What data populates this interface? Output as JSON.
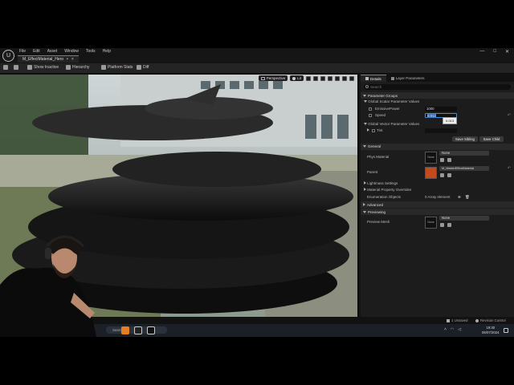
{
  "menu": {
    "logo_text": "U",
    "items": [
      "File",
      "Edit",
      "Asset",
      "Window",
      "Tools",
      "Help"
    ],
    "asset_tab": "M_EffectMaterial_Hero",
    "asset_tab_mark": "•",
    "asset_tab_close": "×",
    "window_controls": [
      "—",
      "□",
      "✕"
    ]
  },
  "toolbar": {
    "show_inactive": "Show Inactive",
    "hierarchy": "Hierarchy",
    "platform_stats": "Platform Stats",
    "diff": "Diff"
  },
  "viewport": {
    "perspective": "Perspective",
    "lit": "Lit"
  },
  "details": {
    "tab_details": "Details",
    "tab_layer": "Layer Parameters",
    "search_placeholder": "Search",
    "section_param_groups": "Parameter Groups",
    "scalar_group": "Global Scalar Parameter Values",
    "emissive_power_label": "EmissivePower",
    "emissive_power_value": "1000",
    "speed_label": "Speed",
    "speed_value": "0.013",
    "speed_tooltip": "0.013",
    "vector_group": "Global Vector Parameter Values",
    "tint_label": "Tint",
    "save_sibling": "Save Sibling",
    "save_child": "Save Child",
    "section_general": "General",
    "phys_material_label": "Phys Material",
    "none_label": "None",
    "phys_material_dd": "None",
    "parent_label": "Parent",
    "parent_value": "M_MasterEffectMaterial",
    "lightmass": "Lightmass Settings",
    "material_overrides": "Material Property Overrides",
    "enumeration_objects": "Enumeration Objects",
    "array_elements": "0 Array element",
    "section_advanced": "Advanced",
    "section_previewing": "Previewing",
    "preview_mesh_label": "Preview Mesh",
    "preview_mesh_dd": "None"
  },
  "statusbar": {
    "unsaved": "1 Unsaved",
    "revision_control": "Revision Control"
  },
  "taskbar": {
    "time": "19:30",
    "date": "06/07/2024",
    "search_text": "Search"
  },
  "colors": {
    "accent": "#3a8fd6",
    "panel_bg": "#1c1c1c",
    "field_bg": "#0f0f0f",
    "parent_thumb": "#c44a1e"
  }
}
